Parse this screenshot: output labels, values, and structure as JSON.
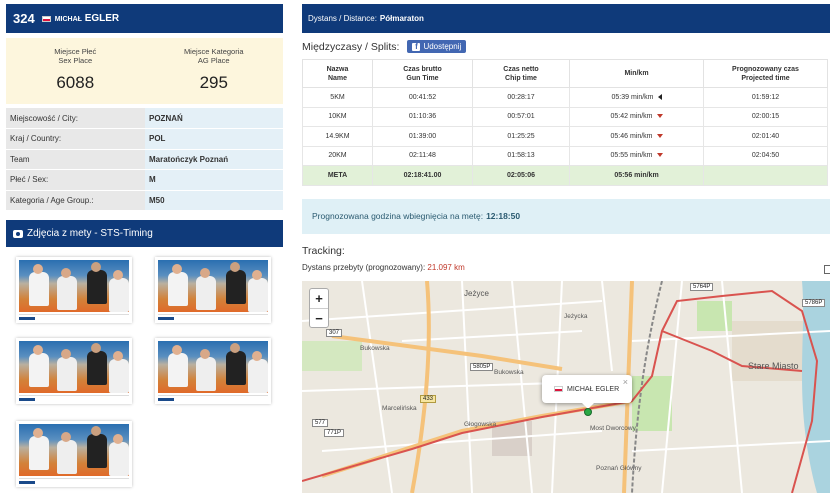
{
  "runner": {
    "bib": "324",
    "first_name": "MICHAŁ",
    "last_name": "EGLER"
  },
  "places": [
    {
      "label_pl": "Miejsce Płeć",
      "label_en": "Sex Place",
      "value": "6088"
    },
    {
      "label_pl": "Miejsce Kategoria",
      "label_en": "AG Place",
      "value": "295"
    }
  ],
  "info": [
    {
      "key": "Miejscowość / City:",
      "value": "POZNAŃ"
    },
    {
      "key": "Kraj / Country:",
      "value": "POL"
    },
    {
      "key": "Team",
      "value": "Maratończyk Poznań"
    },
    {
      "key": "Płeć / Sex:",
      "value": "M"
    },
    {
      "key": "Kategoria / Age Group.:",
      "value": "M50"
    }
  ],
  "photos": {
    "title": "Zdjęcia z mety - STS-Timing"
  },
  "distance": {
    "label": "Dystans / Distance:",
    "value": "Półmaraton"
  },
  "splits": {
    "title": "Międzyczasy / Splits:",
    "share_label": "Udostępnij",
    "headers": [
      {
        "pl": "Nazwa",
        "en": "Name"
      },
      {
        "pl": "Czas brutto",
        "en": "Gun Time"
      },
      {
        "pl": "Czas netto",
        "en": "Chip time"
      },
      {
        "pl": "Min/km",
        "en": ""
      },
      {
        "pl": "Prognozowany czas",
        "en": "Projected time"
      }
    ],
    "rows": [
      {
        "name": "5KM",
        "gun": "00:41:52",
        "chip": "00:28:17",
        "pace": "05:39 min/km",
        "trend": "left",
        "projected": "01:59:12"
      },
      {
        "name": "10KM",
        "gun": "01:10:36",
        "chip": "00:57:01",
        "pace": "05:42 min/km",
        "trend": "down",
        "projected": "02:00:15"
      },
      {
        "name": "14.9KM",
        "gun": "01:39:00",
        "chip": "01:25:25",
        "pace": "05:46 min/km",
        "trend": "down",
        "projected": "02:01:40"
      },
      {
        "name": "20KM",
        "gun": "02:11:48",
        "chip": "01:58:13",
        "pace": "05:55 min/km",
        "trend": "down",
        "projected": "02:04:50"
      },
      {
        "name": "META",
        "gun": "02:18:41.00",
        "chip": "02:05:06",
        "pace": "05:56 min/km",
        "trend": "",
        "projected": ""
      }
    ]
  },
  "predicted": {
    "label": "Prognozowana godzina wbiegnięcia na metę:",
    "value": "12:18:50"
  },
  "tracking": {
    "title": "Tracking:",
    "distance_label": "Dystans przebyty (prognozowany):",
    "distance_value": "21.097 km"
  },
  "map": {
    "zoom_in": "+",
    "zoom_out": "−",
    "popup_name": "MICHAŁ EGLER",
    "popup_close": "×",
    "labels": {
      "jezyce": "Jeżyce",
      "jezycka": "Jeżycka",
      "bukowska1": "Bukowska",
      "bukowska2": "Bukowska",
      "stare_miasto": "Stare Miasto",
      "marcelinska": "Marcelińska",
      "glogowska": "Głogowska",
      "most": "Most Dworcowy",
      "poznan_glowny": "Poznań Główny",
      "r307": "307",
      "r433": "433",
      "r5805p": "5805P",
      "r577": "577",
      "r771p": "771P",
      "r5764p": "5764P",
      "r5786p": "5786P",
      "r2496p": "2496P"
    },
    "colors": {
      "route": "#d9534f",
      "water": "#aad3df",
      "green": "#c8e6b0",
      "primary_road": "#fcd6a4"
    }
  }
}
